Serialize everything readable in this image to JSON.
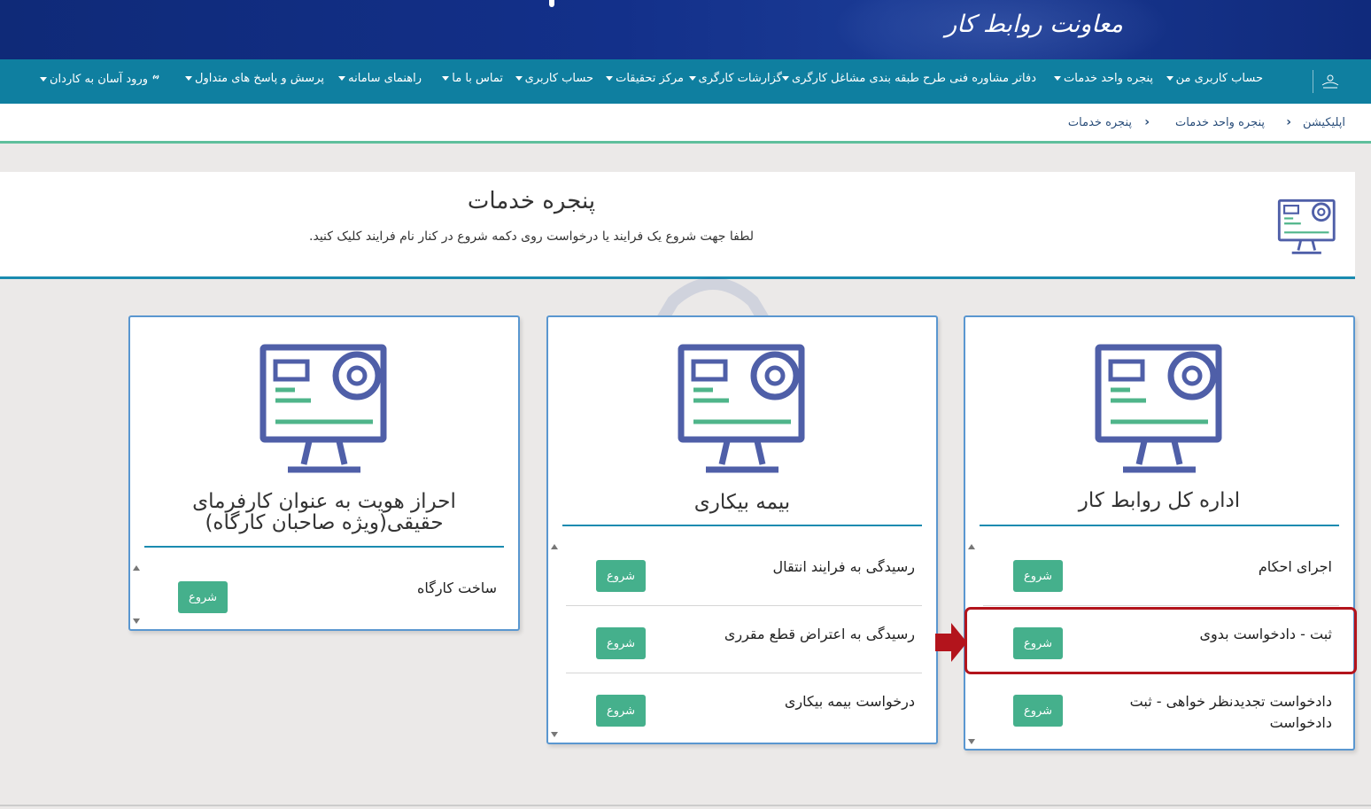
{
  "header": {
    "brand": "معاونت روابط کار",
    "logo_icon": "emblem-icon"
  },
  "nav": {
    "items": [
      {
        "label": "حساب کاربری من",
        "dropdown": true
      },
      {
        "label": "پنجره واحد خدمات",
        "dropdown": true
      },
      {
        "label": "دفاتر مشاوره فنی طرح طبقه بندی مشاغل کارگری",
        "dropdown": true
      },
      {
        "label": "گزارشات کارگری",
        "dropdown": true
      },
      {
        "label": "مرکز تحقیقات",
        "dropdown": true
      },
      {
        "label": "حساب کاربری",
        "dropdown": true
      },
      {
        "label": "تماس با ما",
        "dropdown": true
      },
      {
        "label": "راهنمای سامانه",
        "dropdown": true
      },
      {
        "label": "پرسش و پاسخ های متداول",
        "dropdown": true
      },
      {
        "label": "ورود آسان به کاردان",
        "dropdown": true,
        "icon": "link-icon"
      }
    ]
  },
  "breadcrumb": {
    "items": [
      "اپلیکیشن",
      "پنجره واحد خدمات",
      "پنجره خدمات"
    ]
  },
  "page": {
    "title": "پنجره خدمات",
    "subtitle": "لطفا جهت شروع یک فرایند یا درخواست روی دکمه شروع در کنار نام فرایند کلیک کنید."
  },
  "cards": [
    {
      "title": "اداره کل روابط کار",
      "items": [
        {
          "label": "اجرای احکام",
          "button": "شروع"
        },
        {
          "label": "ثبت - دادخواست بدوی",
          "button": "شروع",
          "highlighted": true
        },
        {
          "label": "دادخواست تجدیدنظر خواهی - ثبت دادخواست",
          "button": "شروع"
        }
      ]
    },
    {
      "title": "بیمه بیکاری",
      "items": [
        {
          "label": "رسیدگی به فرایند انتقال",
          "button": "شروع"
        },
        {
          "label": "رسیدگی به اعتراض قطع مقرری",
          "button": "شروع"
        },
        {
          "label": "درخواست بیمه بیکاری",
          "button": "شروع"
        }
      ]
    },
    {
      "title": "احراز هویت به عنوان کارفرمای حقیقی(ویژه صاحبان کارگاه)",
      "items": [
        {
          "label": "ساخت کارگاه",
          "button": "شروع"
        }
      ]
    }
  ],
  "colors": {
    "banner": "#13308a",
    "navbar": "#0f7fa0",
    "accent_green": "#45b08c",
    "card_border": "#5a97d0",
    "highlight": "#b3141c",
    "icon_blue": "#4f5fa8",
    "icon_green": "#4fb58a"
  }
}
